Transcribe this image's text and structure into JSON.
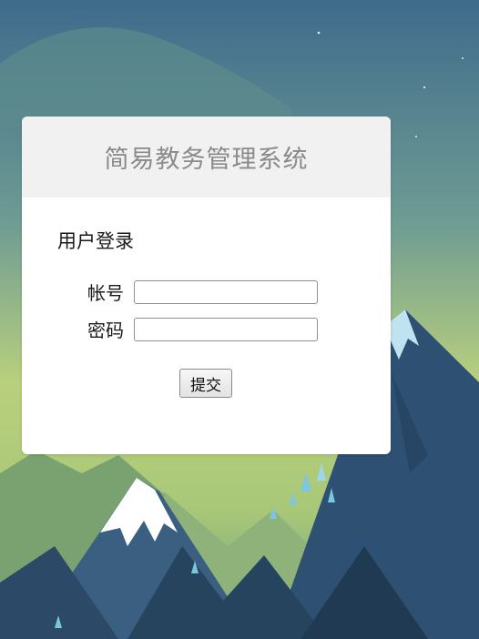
{
  "app": {
    "title": "简易教务管理系统"
  },
  "login": {
    "section_title": "用户登录",
    "account_label": "帐号",
    "account_value": "",
    "password_label": "密码",
    "password_value": "",
    "submit_label": "提交"
  },
  "colors": {
    "header_bg": "#f1f1f1",
    "title_text": "#8a8a8a",
    "sky_top": "#3f6d8a",
    "sky_glow": "#c4d47a",
    "mountain_dark": "#2c4a67",
    "snow": "#ffffff"
  }
}
